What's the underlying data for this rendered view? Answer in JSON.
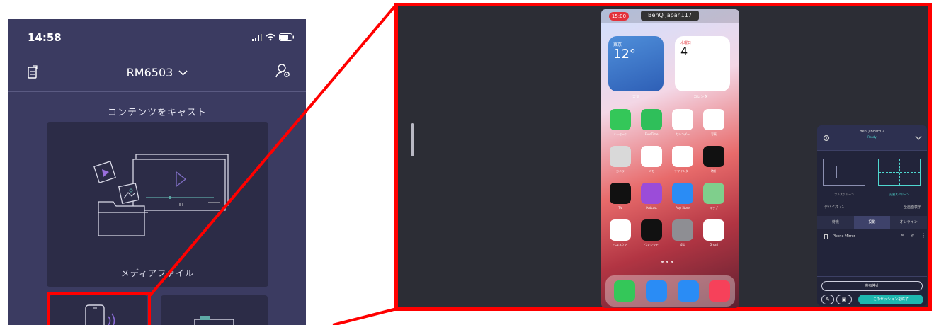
{
  "phone": {
    "time": "14:58",
    "device_name": "RM6503",
    "section_title": "コンテンツをキャスト",
    "media_card_label": "メディアファイル"
  },
  "mirror": {
    "status_time": "15:00",
    "status_network": "BenQ Japan117",
    "widgets": {
      "weather_city": "東京",
      "weather_temp": "12°",
      "weather_label": "天気",
      "calendar_day": "4",
      "calendar_weekday": "木曜日",
      "calendar_label": "カレンダー"
    },
    "apps": [
      {
        "label": "メッセージ",
        "color": "#34c759"
      },
      {
        "label": "FaceTime",
        "color": "#2fbf5a"
      },
      {
        "label": "カレンダー",
        "color": "#ffffff"
      },
      {
        "label": "写真",
        "color": "#ffffff"
      },
      {
        "label": "カメラ",
        "color": "#d9d9d9"
      },
      {
        "label": "メモ",
        "color": "#ffffff"
      },
      {
        "label": "リマインダー",
        "color": "#ffffff"
      },
      {
        "label": "時計",
        "color": "#111111"
      },
      {
        "label": "TV",
        "color": "#111111"
      },
      {
        "label": "Podcast",
        "color": "#9b4cd9"
      },
      {
        "label": "App Store",
        "color": "#2a8cf5"
      },
      {
        "label": "マップ",
        "color": "#7fcf8c"
      },
      {
        "label": "ヘルスケア",
        "color": "#ffffff"
      },
      {
        "label": "ウォレット",
        "color": "#111111"
      },
      {
        "label": "設定",
        "color": "#8e8e93"
      },
      {
        "label": "Gmail",
        "color": "#ffffff"
      }
    ],
    "dock_apps": [
      "phone-icon",
      "mail-icon",
      "safari-icon",
      "music-icon"
    ]
  },
  "panel": {
    "title": "BenQ Board 2",
    "subtitle": "Ready",
    "layout1_label": "フルスクリーン",
    "layout2_label": "分割スクリーン",
    "device_count": "デバイス : 1",
    "device_action": "全画面表示",
    "tabs": [
      "待機",
      "投影",
      "オンライン"
    ],
    "device_name": "Phone Mirror",
    "stop_button": "共有停止",
    "cyan_button": "このセッションを終了"
  },
  "colors": {
    "highlight": "#ff0000",
    "app_bg": "#3b3b61",
    "card_bg": "#2c2c47",
    "accent_cyan": "#1db8b0"
  }
}
